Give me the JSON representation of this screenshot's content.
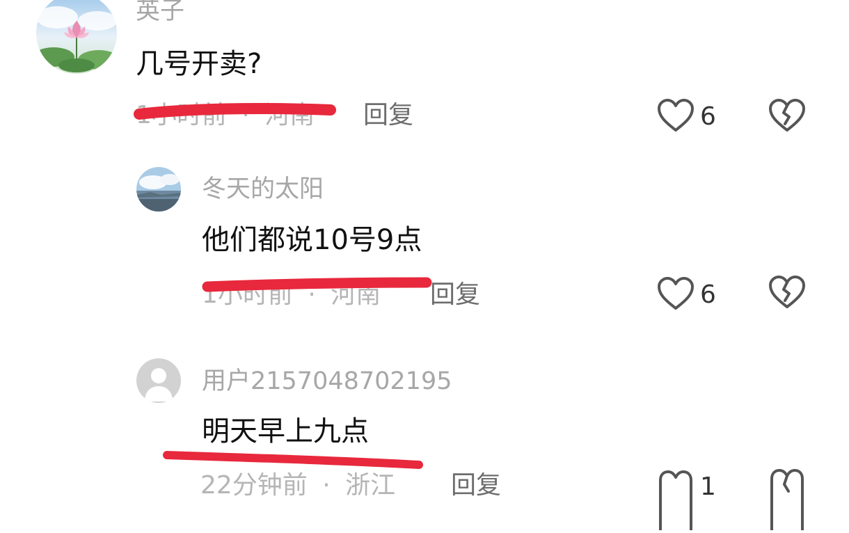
{
  "comments": [
    {
      "user": "英子",
      "text": "几号开卖?",
      "time": "1小时前",
      "separator": "·",
      "location": "河南",
      "reply_label": "回复",
      "like_count": "6"
    },
    {
      "user": "冬天的太阳",
      "text": "他们都说10号9点",
      "time": "1小时前",
      "separator": "·",
      "location": "河南",
      "reply_label": "回复",
      "like_count": "6"
    },
    {
      "user": "用户2157048702195",
      "text": "明天早上九点",
      "time": "22分钟前",
      "separator": "·",
      "location": "浙江",
      "reply_label": "回复",
      "like_count": "1"
    }
  ],
  "colors": {
    "annotation_red": "#e8283c",
    "username_gray": "#a7a7a7",
    "meta_gray": "#b5b5b5"
  }
}
